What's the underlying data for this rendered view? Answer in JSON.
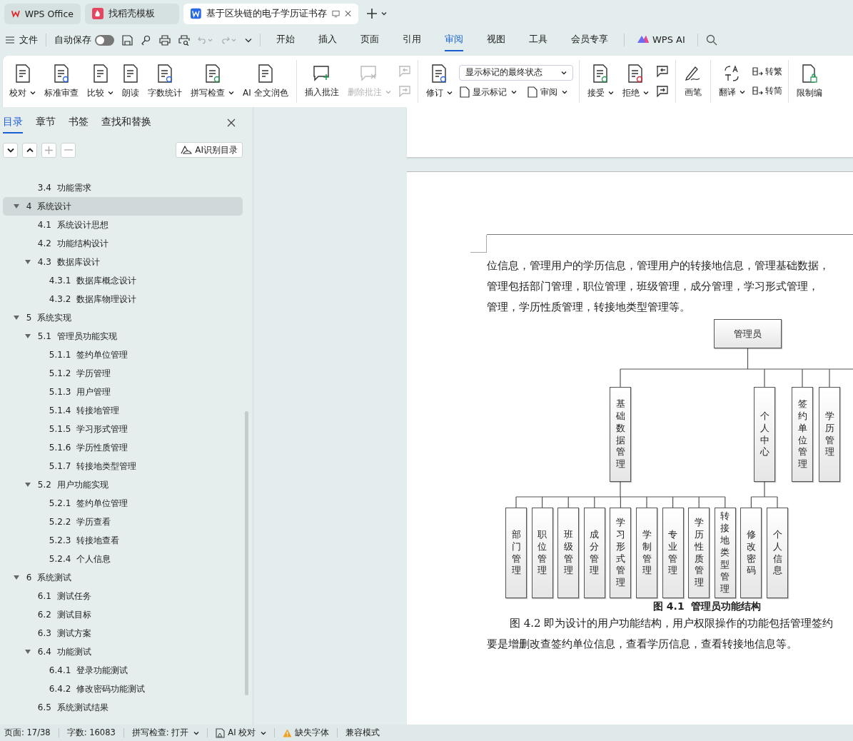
{
  "title_tabs": [
    {
      "label": "WPS Office",
      "kind": "home",
      "selected": false
    },
    {
      "label": "找稻壳模板",
      "kind": "template",
      "selected": false
    },
    {
      "label": "基于区块链的电子学历证书存",
      "kind": "doc",
      "selected": true
    }
  ],
  "menu": {
    "file": "文件",
    "autosave": {
      "label": "自动保存",
      "on": false
    },
    "tabs": [
      {
        "label": "开始",
        "selected": false
      },
      {
        "label": "插入",
        "selected": false
      },
      {
        "label": "页面",
        "selected": false
      },
      {
        "label": "引用",
        "selected": false
      },
      {
        "label": "审阅",
        "selected": true
      },
      {
        "label": "视图",
        "selected": false
      },
      {
        "label": "工具",
        "selected": false
      },
      {
        "label": "会员专享",
        "selected": false
      }
    ],
    "ai": "WPS AI"
  },
  "ribbon": {
    "proof": [
      {
        "label": "校对",
        "dropdown": true
      },
      {
        "label": "标准审查",
        "dropdown": false
      },
      {
        "label": "比较",
        "dropdown": true
      },
      {
        "label": "朗读",
        "dropdown": false
      },
      {
        "label": "字数统计",
        "dropdown": false
      },
      {
        "label": "拼写检查",
        "dropdown": true
      },
      {
        "label": "AI 全文润色",
        "dropdown": false
      }
    ],
    "comments": [
      {
        "label": "插入批注",
        "dropdown": false,
        "disabled": false
      },
      {
        "label": "删除批注",
        "dropdown": true,
        "disabled": true
      }
    ],
    "track": {
      "label": "修订",
      "dropdown": true
    },
    "display_select": "显示标记的最终状态",
    "track_small": [
      {
        "label": "显示标记",
        "dropdown": true
      },
      {
        "label": "审阅",
        "dropdown": true
      }
    ],
    "changes": [
      {
        "label": "接受",
        "dropdown": true
      },
      {
        "label": "拒绝",
        "dropdown": true
      }
    ],
    "pen": "画笔",
    "translate": {
      "label": "翻译",
      "dropdown": true
    },
    "convert": [
      "转繁",
      "转简"
    ],
    "restrict": "限制编"
  },
  "sidebar": {
    "tabs": [
      {
        "label": "目录",
        "selected": true
      },
      {
        "label": "章节",
        "selected": false
      },
      {
        "label": "书签",
        "selected": false
      },
      {
        "label": "查找和替换",
        "selected": false
      }
    ],
    "ai_button": "AI识别目录",
    "continued": [
      {
        "label": "3.4  功能需求",
        "selected": false
      }
    ],
    "toc": [
      {
        "label": "4  系统设计",
        "selected": true,
        "expanded": true,
        "children": [
          {
            "label": "4.1  系统设计思想",
            "selected": false
          },
          {
            "label": "4.2  功能结构设计",
            "selected": false
          },
          {
            "label": "4.3  数据库设计",
            "selected": false,
            "expanded": true,
            "children": [
              {
                "label": "4.3.1  数据库概念设计",
                "selected": false
              },
              {
                "label": "4.3.2  数据库物理设计",
                "selected": false
              }
            ]
          }
        ]
      },
      {
        "label": "5  系统实现",
        "selected": false,
        "expanded": true,
        "children": [
          {
            "label": "5.1  管理员功能实现",
            "selected": false,
            "expanded": true,
            "children": [
              {
                "label": "5.1.1  签约单位管理",
                "selected": false
              },
              {
                "label": "5.1.2  学历管理",
                "selected": false
              },
              {
                "label": "5.1.3  用户管理",
                "selected": false
              },
              {
                "label": "5.1.4  转接地管理",
                "selected": false
              },
              {
                "label": "5.1.5  学习形式管理",
                "selected": false
              },
              {
                "label": "5.1.6  学历性质管理",
                "selected": false
              },
              {
                "label": "5.1.7  转接地类型管理",
                "selected": false
              }
            ]
          },
          {
            "label": "5.2  用户功能实现",
            "selected": false,
            "expanded": true,
            "children": [
              {
                "label": "5.2.1  签约单位管理",
                "selected": false
              },
              {
                "label": "5.2.2  学历查看",
                "selected": false
              },
              {
                "label": "5.2.3  转接地查看",
                "selected": false
              },
              {
                "label": "5.2.4  个人信息",
                "selected": false
              }
            ]
          }
        ]
      },
      {
        "label": "6  系统测试",
        "selected": false,
        "expanded": true,
        "children": [
          {
            "label": "6.1  测试任务",
            "selected": false
          },
          {
            "label": "6.2  测试目标",
            "selected": false
          },
          {
            "label": "6.3  测试方案",
            "selected": false
          },
          {
            "label": "6.4  功能测试",
            "selected": false,
            "expanded": true,
            "children": [
              {
                "label": "6.4.1  登录功能测试",
                "selected": false
              },
              {
                "label": "6.4.2  修改密码功能测试",
                "selected": false
              }
            ]
          },
          {
            "label": "6.5  系统测试结果",
            "selected": false
          }
        ]
      }
    ]
  },
  "document": {
    "paragraph_1": [
      "位信息，管理用户的学历信息，管理用户的转接地信息，管理基础数据，",
      "管理包括部门管理，职位管理，班级管理，成分管理，学习形式管理，",
      "管理，学历性质管理，转接地类型管理等。"
    ],
    "org_chart": {
      "label": "管理员",
      "children": [
        {
          "label": "基础数据管理",
          "children": [
            {
              "label": "部门管理"
            },
            {
              "label": "职位管理"
            },
            {
              "label": "班级管理"
            },
            {
              "label": "成分管理"
            },
            {
              "label": "学习形式管理"
            },
            {
              "label": "学制管理"
            },
            {
              "label": "专业管理"
            },
            {
              "label": "学历性质管理"
            },
            {
              "label": "转接地类型管理"
            }
          ]
        },
        {
          "label": "个人中心",
          "children": [
            {
              "label": "修改密码"
            },
            {
              "label": "个人信息"
            }
          ]
        },
        {
          "label": "签约单位管理"
        },
        {
          "label": "学历管理"
        }
      ]
    },
    "caption": "**图 4.1  管理员功能结构**",
    "paragraph_2": [
      "图 4.2 即为设计的用户功能结构，用户权限操作的功能包括管理签约",
      "要是增删改查签约单位信息，查看学历信息，查看转接地信息等。"
    ]
  },
  "status_bar": {
    "page": "页面: 17/38",
    "words": "字数: 16083",
    "spell": "拼写检查: 打开",
    "ai_check": "AI 校对",
    "missing_fonts": "缺失字体",
    "compat": "兼容模式"
  }
}
